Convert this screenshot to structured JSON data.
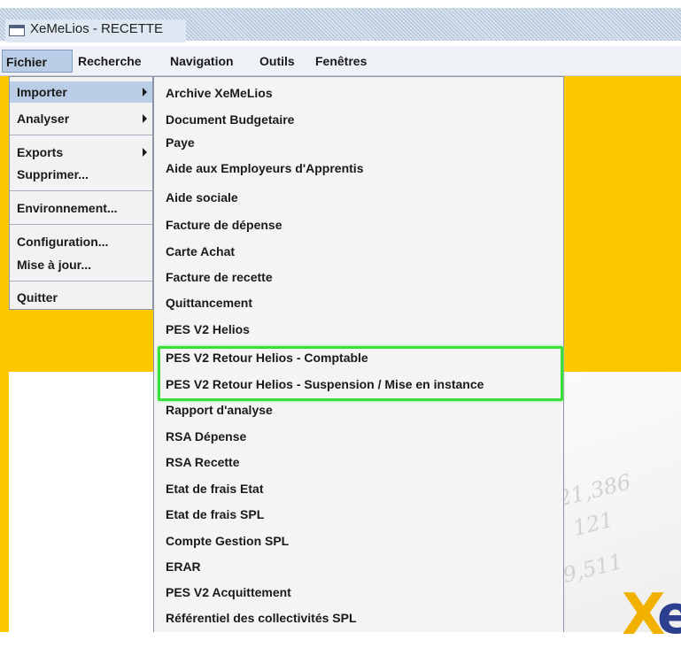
{
  "window": {
    "title": "XeMeLios - RECETTE",
    "icon": "window-icon"
  },
  "menubar": {
    "items": [
      "Fichier",
      "Recherche",
      "Navigation",
      "Outils",
      "Fenêtres"
    ],
    "active": "Fichier"
  },
  "file_menu": {
    "items": [
      {
        "label": "Importer",
        "submenu": true,
        "active": true
      },
      {
        "label": "Analyser",
        "submenu": true
      },
      {
        "label": "Exports",
        "submenu": true
      },
      {
        "label": "Supprimer..."
      },
      {
        "label": "Environnement..."
      },
      {
        "label": "Configuration..."
      },
      {
        "label": "Mise à jour..."
      },
      {
        "label": "Quitter"
      }
    ]
  },
  "import_submenu": {
    "items": [
      "Archive XeMeLios",
      "Document Budgetaire",
      "Paye",
      "Aide aux Employeurs d'Apprentis",
      "Aide sociale",
      "Facture de dépense",
      "Carte Achat",
      "Facture de recette",
      "Quittancement",
      "PES V2 Helios",
      "PES V2 Retour Helios - Comptable",
      "PES V2 Retour Helios - Suspension / Mise en instance",
      "Rapport d'analyse",
      "RSA Dépense",
      "RSA Recette",
      "Etat de frais Etat",
      "Etat de frais SPL",
      "Compte Gestion SPL",
      "ERAR",
      "PES V2 Acquittement",
      "Référentiel des collectivités SPL"
    ],
    "highlighted": [
      "PES V2 Retour Helios - Comptable",
      "PES V2 Retour Helios - Suspension / Mise en instance"
    ]
  },
  "background": {
    "numbers": [
      "21,386",
      "121",
      "9,511"
    ]
  },
  "colors": {
    "background_yellow": "#fdc800",
    "menu_active": "#b9cde6",
    "highlight_border": "#38e038"
  }
}
